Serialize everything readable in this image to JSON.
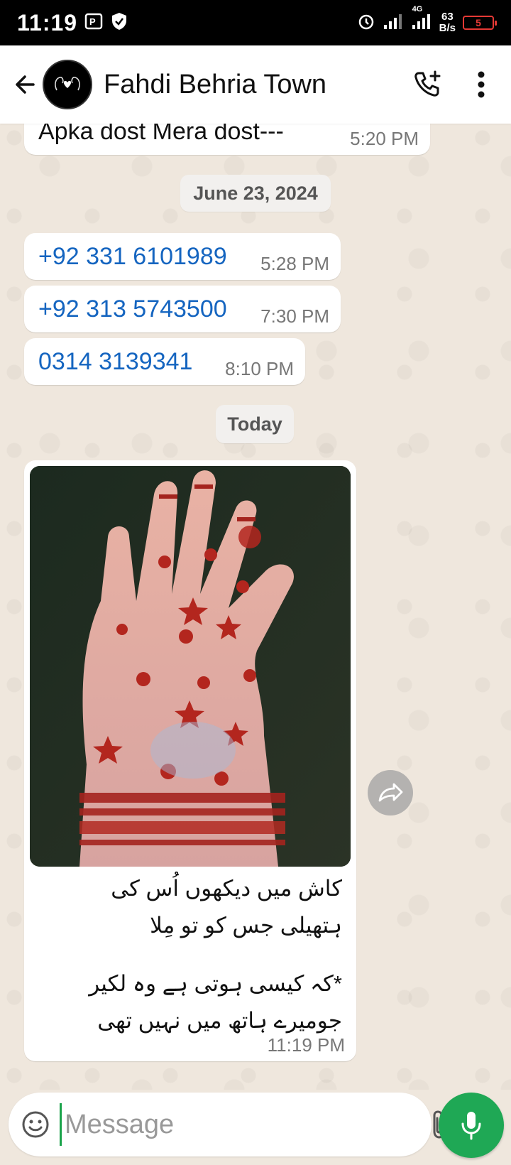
{
  "status_bar": {
    "time": "11:19",
    "network_type": "4G",
    "speed_value": "63",
    "speed_unit": "B/s",
    "battery_level": "5",
    "battery_color": "#e53935"
  },
  "header": {
    "title": "Fahdi Behria Town",
    "icons": [
      "back-arrow-icon",
      "avatar",
      "add-call-icon",
      "more-vertical-icon"
    ]
  },
  "messages": [
    {
      "text": "Apka dost Mera dost---",
      "time": "5:20 PM"
    },
    {
      "text": "+92 331 6101989",
      "time": "5:28 PM",
      "link": true
    },
    {
      "text": "+92 313 5743500",
      "time": "7:30 PM",
      "link": true
    },
    {
      "text": "0314 3139341",
      "time": "8:10 PM",
      "link": true
    }
  ],
  "dates": {
    "first": "June 23, 2024",
    "second": "Today"
  },
  "image_message": {
    "caption_line1": "کاش میں دیکھوں اُس کی",
    "caption_line2": "ہتھیلی جس کو تو مِلا",
    "caption_line3": "*کہ کیسی ہوتی ہے وہ لکیر",
    "caption_line4": "جومیرے ہاتھ میں نہیں تھی",
    "time": "11:19 PM"
  },
  "input": {
    "placeholder": "Message"
  },
  "colors": {
    "accent": "#1fa855",
    "link": "#1565c0",
    "chat_background": "#efe7dd"
  }
}
